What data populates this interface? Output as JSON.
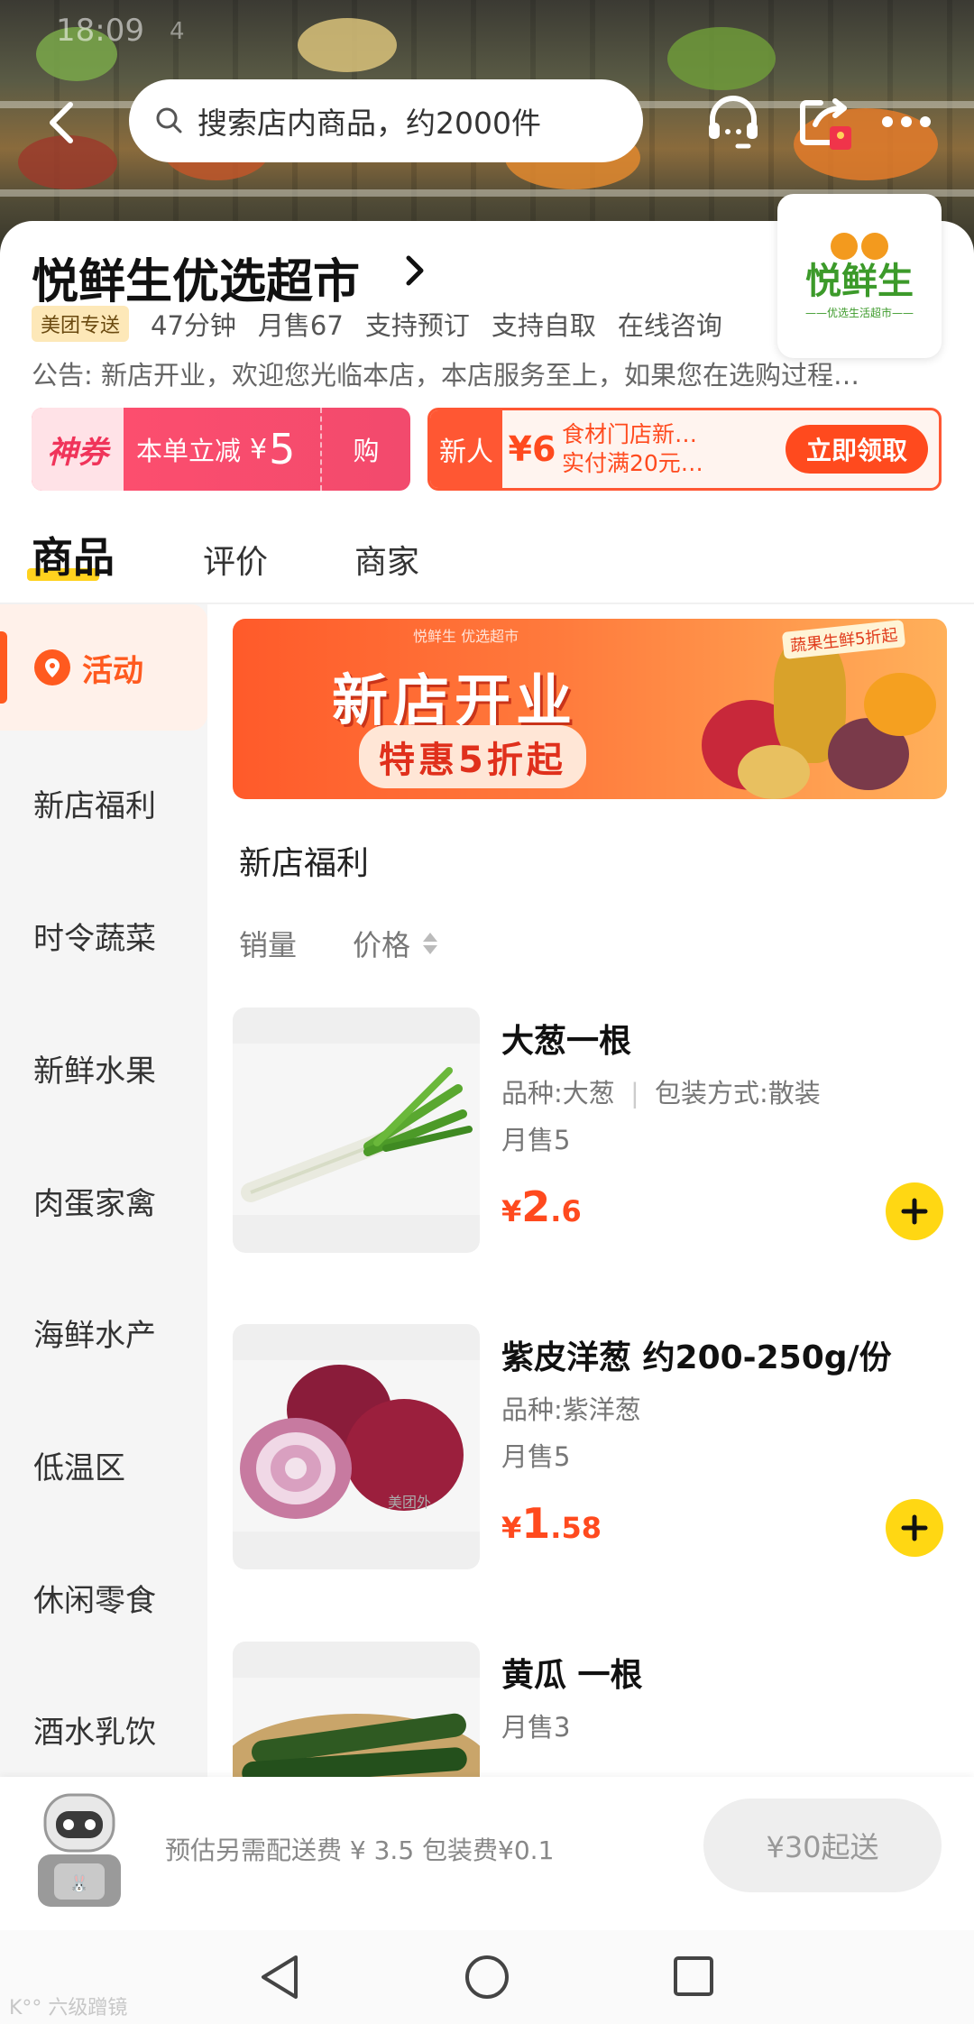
{
  "status_bar": {
    "time": "18:09",
    "signal": "4"
  },
  "search": {
    "placeholder": "搜索店内商品，约2000件"
  },
  "store": {
    "name": "悦鲜生优选超市",
    "logo_text": "悦鲜生",
    "logo_sub": "——优选生活超市——",
    "badge": "美团专送",
    "delivery_time": "47分钟",
    "monthly_sales": "月售67",
    "tags": [
      "支持预订",
      "支持自取",
      "在线咨询"
    ],
    "notice": "公告: 新店开业，欢迎您光临本店，本店服务至上，如果您在选购过程…"
  },
  "coupons": {
    "shenquan": {
      "label": "神券",
      "text": "本单立减",
      "currency": "¥",
      "amount": "5",
      "action": "购"
    },
    "newuser": {
      "tag": "新人",
      "amount": "¥6",
      "line1": "食材门店新…",
      "line2": "实付满20元…",
      "action": "立即领取"
    }
  },
  "tabs": [
    {
      "label": "商品",
      "active": true
    },
    {
      "label": "评价",
      "active": false
    },
    {
      "label": "商家",
      "active": false
    }
  ],
  "sidebar": {
    "items": [
      {
        "label": "活动",
        "active": true
      },
      {
        "label": "新店福利"
      },
      {
        "label": "时令蔬菜"
      },
      {
        "label": "新鲜水果"
      },
      {
        "label": "肉蛋家禽"
      },
      {
        "label": "海鲜水产"
      },
      {
        "label": "低温区"
      },
      {
        "label": "休闲零食"
      },
      {
        "label": "酒水乳饮"
      }
    ]
  },
  "banner": {
    "title": "新店开业",
    "subtitle": "特惠5折起",
    "tag": "蔬果生鲜5折起",
    "brand": "悦鲜生 优选超市"
  },
  "section": {
    "title": "新店福利",
    "sort_sales": "销量",
    "sort_price": "价格"
  },
  "products": [
    {
      "name": "大葱一根",
      "spec": "品种:大葱",
      "spec2": "包装方式:散装",
      "sold": "月售5",
      "currency": "¥",
      "price_int": "2",
      "price_dec": ".6"
    },
    {
      "name": "紫皮洋葱 约200-250g/份",
      "spec": "品种:紫洋葱",
      "spec2": "",
      "sold": "月售5",
      "currency": "¥",
      "price_int": "1",
      "price_dec": ".58",
      "watermark": "美团外"
    },
    {
      "name": "黄瓜 一根",
      "spec": "",
      "spec2": "",
      "sold": "月售3",
      "currency": "¥",
      "price_int": "",
      "price_dec": ""
    }
  ],
  "cart": {
    "fee_text": "预估另需配送费 ¥ 3.5  包装费¥0.1",
    "min_order": "¥30起送"
  },
  "watermark": "K°° 六级蹭镜",
  "colors": {
    "accent": "#ff5a1f",
    "price": "#ff4a1e",
    "add_button": "#ffd713",
    "coupon_pink": "#f24a6d"
  }
}
